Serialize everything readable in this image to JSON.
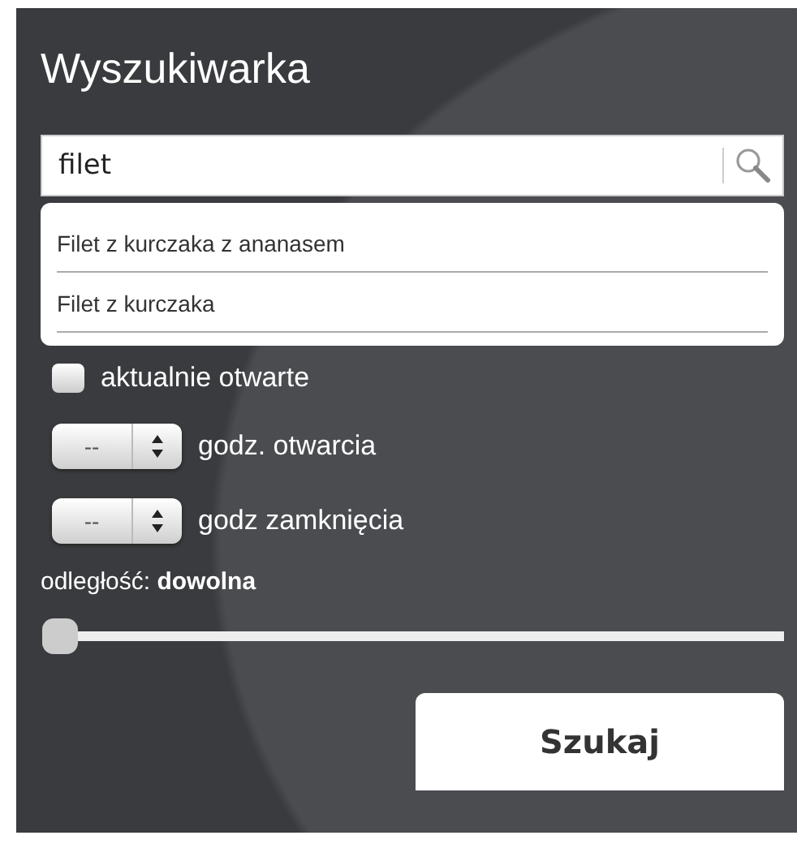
{
  "title": "Wyszukiwarka",
  "search": {
    "value": "filet"
  },
  "suggestions": [
    "Filet z kurczaka z ananasem",
    "Filet z kurczaka"
  ],
  "open_now": {
    "label": "aktualnie otwarte",
    "checked": false
  },
  "time_selects": [
    {
      "value": "--",
      "label": "godz. otwarcia"
    },
    {
      "value": "--",
      "label": "godz zamknięcia"
    }
  ],
  "distance": {
    "label": "odległość: **dowolna**",
    "level": 0
  },
  "button": "Szukaj"
}
